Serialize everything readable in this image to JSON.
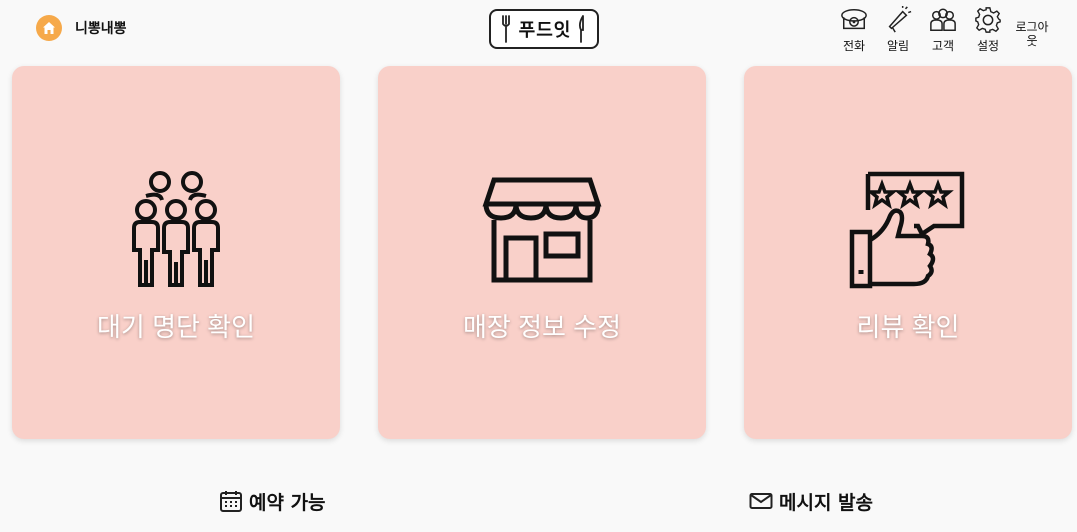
{
  "header": {
    "store_name": "니뽕내뽕",
    "logo_text": "푸드잇",
    "nav": [
      {
        "label": "전화",
        "icon": "telephone-icon"
      },
      {
        "label": "알림",
        "icon": "megaphone-icon"
      },
      {
        "label": "고객",
        "icon": "users-icon"
      },
      {
        "label": "설정",
        "icon": "gear-icon"
      }
    ],
    "logout_label": "로그아웃"
  },
  "cards": [
    {
      "title": "대기 명단 확인",
      "icon": "people-group-icon"
    },
    {
      "title": "매장 정보 수정",
      "icon": "storefront-icon"
    },
    {
      "title": "리뷰 확인",
      "icon": "thumbs-up-review-icon"
    }
  ],
  "bottom": {
    "reservation_label": "예약 가능",
    "message_label": "메시지 발송"
  },
  "colors": {
    "card_bg": "#f9d0c9",
    "home_button": "#f6a94a",
    "page_bg": "#f9f9f9"
  }
}
